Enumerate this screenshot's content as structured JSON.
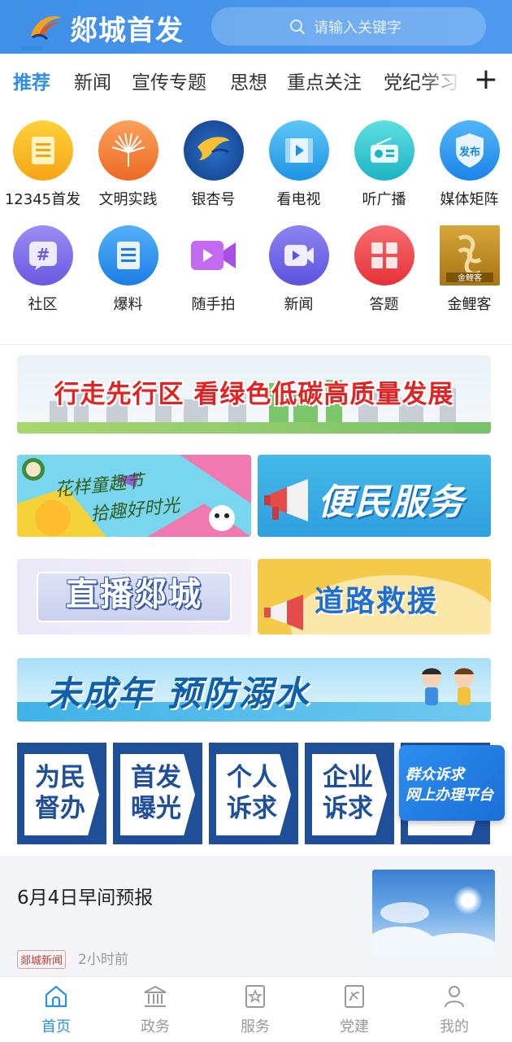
{
  "header": {
    "app_title": "郯城首发",
    "search_placeholder": "请输入关键字"
  },
  "tabs": [
    {
      "label": "推荐",
      "active": true
    },
    {
      "label": "新闻"
    },
    {
      "label": "宣传专题"
    },
    {
      "label": "思想"
    },
    {
      "label": "重点关注"
    },
    {
      "label": "党纪学习"
    }
  ],
  "tabs_more_label": "+",
  "grid_row1": [
    {
      "label": "12345首发",
      "icon": "document-icon",
      "color": "#f7b21a"
    },
    {
      "label": "文明实践",
      "icon": "palm-fan-icon",
      "color": "#f07b2e"
    },
    {
      "label": "银杏号",
      "icon": "ginkgo-leaf-icon",
      "color": "#1c5aa8"
    },
    {
      "label": "看电视",
      "icon": "film-icon",
      "color": "#2da9e8"
    },
    {
      "label": "听广播",
      "icon": "radio-icon",
      "color": "#2ec4c9"
    },
    {
      "label": "媒体矩阵",
      "icon": "shield-badge-icon",
      "color": "#2c9cf0"
    }
  ],
  "grid_row2": [
    {
      "label": "社区",
      "icon": "hashtag-icon",
      "color": "#7b68e8"
    },
    {
      "label": "爆料",
      "icon": "notepad-icon",
      "color": "#2d8ff0"
    },
    {
      "label": "随手拍",
      "icon": "video-camera-icon",
      "color": "#b05ce8"
    },
    {
      "label": "新闻",
      "icon": "video-play-icon",
      "color": "#6e66e6"
    },
    {
      "label": "答题",
      "icon": "grid-icon",
      "color": "#f0474c"
    },
    {
      "label": "金鲤客",
      "icon": "golden-carp-logo",
      "color": "#c9952c"
    }
  ],
  "shield_text": "发布",
  "carp_text": "金鲤客",
  "banners": {
    "green_development": "行走先行区 看绿色低碳高质量发展",
    "festival_line1": "花样童趣节",
    "festival_line2": "拾趣好时光",
    "convenience": "便民服务",
    "live": "直播郯城",
    "road_rescue": "道路救援",
    "drowning": "未成年 预防溺水"
  },
  "services": [
    {
      "line1": "为民",
      "line2": "督办"
    },
    {
      "line1": "首发",
      "line2": "曝光"
    },
    {
      "line1": "个人",
      "line2": "诉求"
    },
    {
      "line1": "企业",
      "line2": "诉求"
    }
  ],
  "float_card": {
    "line1": "群众诉求",
    "line2": "网上办理平台"
  },
  "news": {
    "title": "6月4日早间预报",
    "source": "郯城新闻",
    "time": "2小时前"
  },
  "bottom_nav": [
    {
      "label": "首页",
      "icon": "home-icon",
      "active": true
    },
    {
      "label": "政务",
      "icon": "government-building-icon"
    },
    {
      "label": "服务",
      "icon": "bookmark-star-icon"
    },
    {
      "label": "党建",
      "icon": "party-emblem-icon"
    },
    {
      "label": "我的",
      "icon": "user-icon"
    }
  ],
  "colors": {
    "header_blue": "#4a90e2",
    "accent_blue": "#2f8ee5",
    "service_blue": "#1f4f99",
    "banner_red": "#e02424"
  }
}
